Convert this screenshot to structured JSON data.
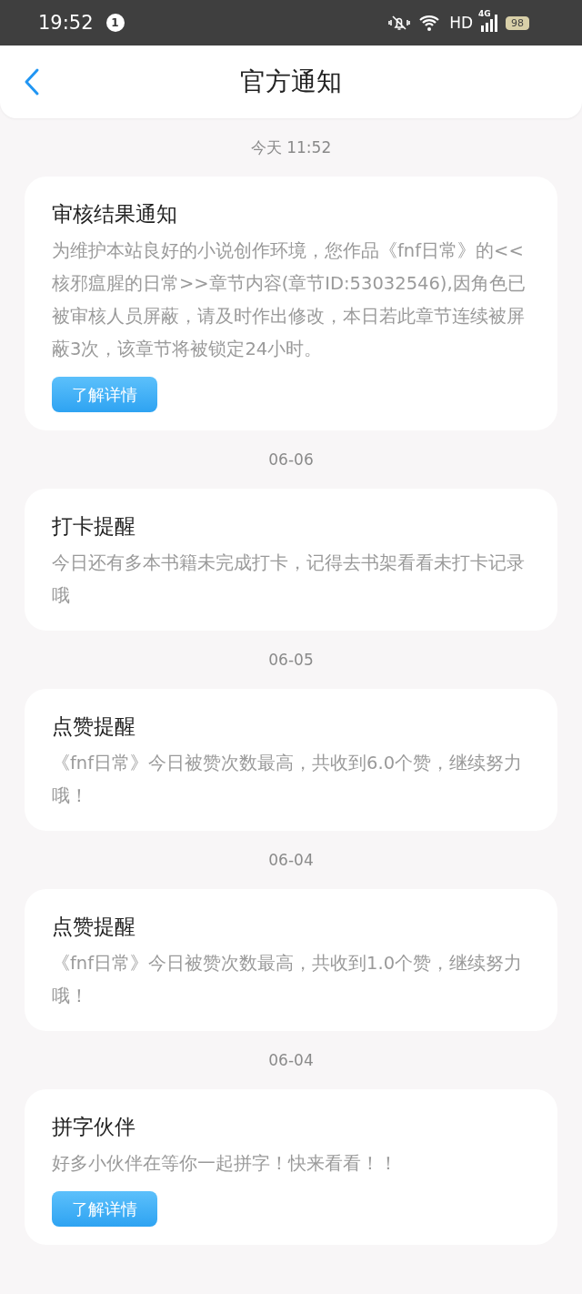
{
  "status_bar": {
    "time": "19:52",
    "notification_count": "1",
    "network": "HD",
    "signal_type": "4G",
    "battery": "98"
  },
  "header": {
    "title": "官方通知"
  },
  "messages": [
    {
      "date": "今天 11:52",
      "title": "审核结果通知",
      "body": "为维护本站良好的小说创作环境，您作品《fnf日常》的<<核邪瘟腥的日常>>章节内容(章节ID:53032546),因角色已被审核人员屏蔽，请及时作出修改，本日若此章节连续被屏蔽3次，该章节将被锁定24小时。",
      "button": "了解详情"
    },
    {
      "date": "06-06",
      "title": "打卡提醒",
      "body": "今日还有多本书籍未完成打卡，记得去书架看看未打卡记录哦"
    },
    {
      "date": "06-05",
      "title": "点赞提醒",
      "body": "《fnf日常》今日被赞次数最高，共收到6.0个赞，继续努力哦！"
    },
    {
      "date": "06-04",
      "title": "点赞提醒",
      "body": "《fnf日常》今日被赞次数最高，共收到1.0个赞，继续努力哦！"
    },
    {
      "date": "06-04",
      "title": "拼字伙伴",
      "body": "好多小伙伴在等你一起拼字！快来看看！！",
      "button": "了解详情"
    }
  ]
}
